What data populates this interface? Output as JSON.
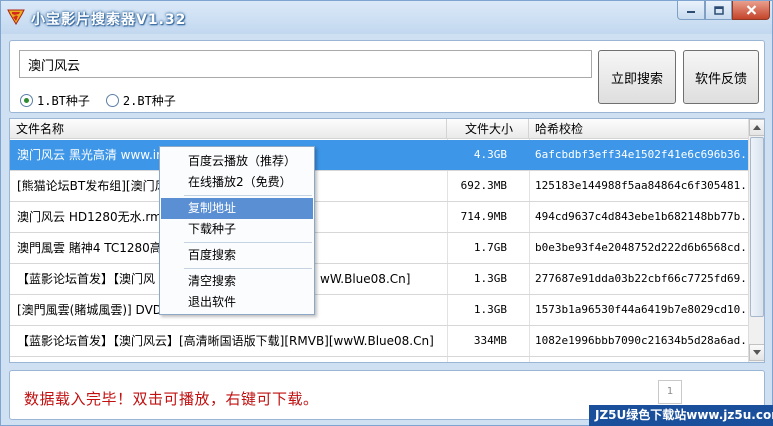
{
  "window": {
    "title": "小宝影片搜索器V1.32"
  },
  "search": {
    "value": "澳门风云",
    "radio1": "1.BT种子",
    "radio2": "2.BT种子",
    "search_button": "立即搜索",
    "feedback_button": "软件反馈"
  },
  "table": {
    "headers": {
      "name": "文件名称",
      "size": "文件大小",
      "hash": "哈希校检"
    },
    "rows": [
      {
        "name": "澳门风云 黑光高清 www.im",
        "size": "4.3GB",
        "hash": "6afcbdbf3eff34e1502f41e6c696b36..."
      },
      {
        "name": "[熊猫论坛BT发布组][澳门风",
        "size": "692.3MB",
        "hash": "125183e144988f5aa84864c6f305481..."
      },
      {
        "name": "澳门风云 HD1280无水.rmvb",
        "size": "714.9MB",
        "hash": "494cd9637c4d843ebe1b682148bb77b..."
      },
      {
        "name": "澳門風雲 賭神4 TC1280高清",
        "size": "1.7GB",
        "hash": "b0e3be93f4e2048752d222d6b6568cd..."
      },
      {
        "name": "【蓝影论坛首发】【澳门风",
        "size": "1.3GB",
        "hash": "277687e91dda03b22cbf66c7725fd69..."
      },
      {
        "name": "[澳門風雲(賭城風雲)] DVD",
        "size": "1.3GB",
        "hash": "1573b1a96530f44a6419b7e8029cd10..."
      },
      {
        "name": "【蓝影论坛首发】【澳门风云】[高清晰国语版下载][RMVB][wwW.Blue08.Cn]",
        "size": "334MB",
        "hash": "1082e1996bbb7090c21634b5d28a6ad..."
      }
    ],
    "overflow_text_row4": "wW.Blue08.Cn]"
  },
  "context_menu": {
    "items": [
      "百度云播放（推荐）",
      "在线播放2（免费）",
      "复制地址",
      "下载种子",
      "百度搜索",
      "清空搜索",
      "退出软件"
    ]
  },
  "status": {
    "message": "数据载入完毕！双击可播放，右键可下载。",
    "page": "1"
  },
  "watermark": {
    "text": "JZ5U绿色下载站www.jz5u.com"
  },
  "colors": {
    "selected_row": "#3d96e8",
    "status_text": "#c01010",
    "menu_highlight": "#5b8fd4"
  }
}
